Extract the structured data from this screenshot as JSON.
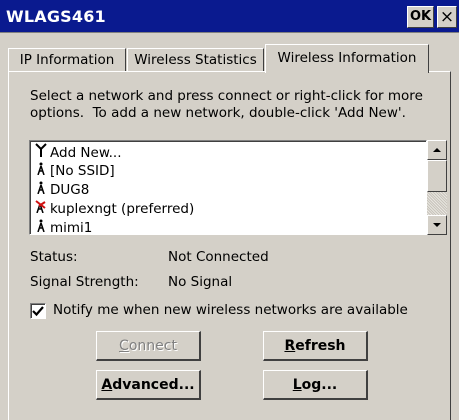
{
  "window": {
    "title": "WLAGS461",
    "ok_label": "OK",
    "close_glyph": "×"
  },
  "tabs": [
    {
      "label": "IP Information",
      "active": false
    },
    {
      "label": "Wireless Statistics",
      "active": false
    },
    {
      "label": "Wireless Information",
      "active": true
    }
  ],
  "instructions": {
    "line1": "Select a network and press connect or right-click for more",
    "line2": "options.  To add a new network, double-click 'Add New'."
  },
  "networks": [
    {
      "icon": "antenna-icon",
      "label": "Add New..."
    },
    {
      "icon": "signal-tower-icon",
      "label": "[No SSID]"
    },
    {
      "icon": "signal-tower-icon",
      "label": "DUG8"
    },
    {
      "icon": "signal-tower-unavailable-icon",
      "label": "kuplexngt (preferred)"
    },
    {
      "icon": "signal-tower-icon",
      "label": "mimi1"
    }
  ],
  "status": {
    "status_label": "Status:",
    "status_value": "Not Connected",
    "signal_label": "Signal Strength:",
    "signal_value": "No Signal"
  },
  "notify": {
    "label": "Notify me when new wireless networks are available",
    "checked": true
  },
  "buttons": {
    "connect": {
      "first": "C",
      "rest": "onnect",
      "enabled": false
    },
    "refresh": {
      "first": "R",
      "rest": "efresh"
    },
    "advanced": {
      "first": "A",
      "rest": "dvanced..."
    },
    "log": {
      "first": "L",
      "rest": "og..."
    }
  },
  "colors": {
    "titlebar": "#0a1a8f",
    "face": "#d4d0c8",
    "preferred_icon": "#d01010"
  }
}
